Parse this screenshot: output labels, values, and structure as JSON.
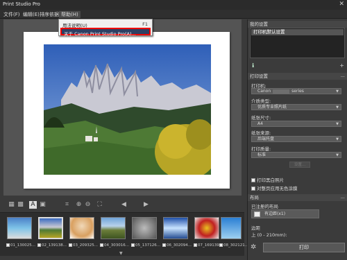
{
  "window": {
    "title": "Print Studio Pro",
    "close_glyph": "✕"
  },
  "menubar": {
    "items": [
      "文件(F)",
      "编辑(E)",
      "排序依据",
      "帮助(H)"
    ]
  },
  "help_menu": {
    "items": [
      {
        "label": "用法说明(U)",
        "shortcut": "F1"
      },
      {
        "label": "关于 Canon Print Studio Pro(A)..."
      }
    ]
  },
  "thumbnails": [
    {
      "label": "01_130025..."
    },
    {
      "label": "02_139138..."
    },
    {
      "label": "03_209325..."
    },
    {
      "label": "04_303016..."
    },
    {
      "label": "05_137126..."
    },
    {
      "label": "06_302094..."
    },
    {
      "label": "07_169139..."
    },
    {
      "label": "08_302121..."
    }
  ],
  "right_panel": {
    "my_settings": {
      "header": "我的设置",
      "default_row": "打印机默认设置"
    },
    "print_settings": {
      "header": "打印设置",
      "printer_label": "打印机:",
      "printer_value_left": "Canon",
      "printer_value_right": "series",
      "media_label": "介质类型:",
      "media_value": "优质专业照片纸",
      "size_label": "纸张尺寸:",
      "size_value": "A4",
      "source_label": "纸张来源:",
      "source_value": "后端托盘",
      "quality_label": "打印质量:",
      "quality_value": "标准",
      "settings_button": "设置...",
      "bw_photo": "打印黑白照片",
      "borderless": "对整页应用无色涂膜"
    },
    "layout": {
      "header": "布局",
      "selected_label": "已注册的布局",
      "layout_value": "有边距(x1)",
      "margin_label": "边距",
      "margin_value": "上 (0 - 210mm):"
    },
    "print_button": "打印"
  },
  "colors": {
    "menu_highlight_border": "#e00000",
    "menu_highlight_fill": "#2e3f63"
  }
}
